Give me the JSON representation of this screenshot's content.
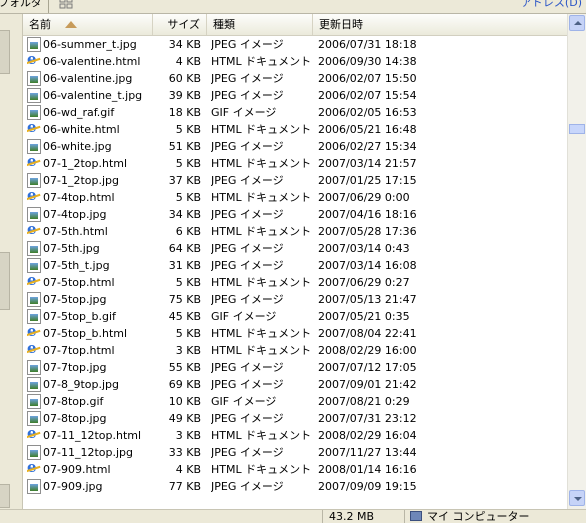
{
  "toolbar": {
    "folders_label": "フォルダ",
    "address_label": "アドレス(D)"
  },
  "columns": {
    "name": "名前",
    "size": "サイズ",
    "type": "種類",
    "modified": "更新日時"
  },
  "sort": {
    "column": "name",
    "direction": "ascending"
  },
  "files": [
    {
      "name": "06-summer_t.jpg",
      "icon": "jpeg-image-icon",
      "size": "34 KB",
      "type": "JPEG イメージ",
      "modified": "2006/07/31 18:18"
    },
    {
      "name": "06-valentine.html",
      "icon": "html-document-icon",
      "size": "4 KB",
      "type": "HTML ドキュメント",
      "modified": "2006/09/30 14:38"
    },
    {
      "name": "06-valentine.jpg",
      "icon": "jpeg-image-icon",
      "size": "60 KB",
      "type": "JPEG イメージ",
      "modified": "2006/02/07 15:50"
    },
    {
      "name": "06-valentine_t.jpg",
      "icon": "jpeg-image-icon",
      "size": "39 KB",
      "type": "JPEG イメージ",
      "modified": "2006/02/07 15:54"
    },
    {
      "name": "06-wd_raf.gif",
      "icon": "gif-image-icon",
      "size": "18 KB",
      "type": "GIF イメージ",
      "modified": "2006/02/05 16:53"
    },
    {
      "name": "06-white.html",
      "icon": "html-document-icon",
      "size": "5 KB",
      "type": "HTML ドキュメント",
      "modified": "2006/05/21 16:48"
    },
    {
      "name": "06-white.jpg",
      "icon": "jpeg-image-icon",
      "size": "51 KB",
      "type": "JPEG イメージ",
      "modified": "2006/02/27 15:34"
    },
    {
      "name": "07-1_2top.html",
      "icon": "html-document-icon",
      "size": "5 KB",
      "type": "HTML ドキュメント",
      "modified": "2007/03/14 21:57"
    },
    {
      "name": "07-1_2top.jpg",
      "icon": "jpeg-image-icon",
      "size": "37 KB",
      "type": "JPEG イメージ",
      "modified": "2007/01/25 17:15"
    },
    {
      "name": "07-4top.html",
      "icon": "html-document-icon",
      "size": "5 KB",
      "type": "HTML ドキュメント",
      "modified": "2007/06/29 0:00"
    },
    {
      "name": "07-4top.jpg",
      "icon": "jpeg-image-icon",
      "size": "34 KB",
      "type": "JPEG イメージ",
      "modified": "2007/04/16 18:16"
    },
    {
      "name": "07-5th.html",
      "icon": "html-document-icon",
      "size": "6 KB",
      "type": "HTML ドキュメント",
      "modified": "2007/05/28 17:36"
    },
    {
      "name": "07-5th.jpg",
      "icon": "jpeg-image-icon",
      "size": "64 KB",
      "type": "JPEG イメージ",
      "modified": "2007/03/14 0:43"
    },
    {
      "name": "07-5th_t.jpg",
      "icon": "jpeg-image-icon",
      "size": "31 KB",
      "type": "JPEG イメージ",
      "modified": "2007/03/14 16:08"
    },
    {
      "name": "07-5top.html",
      "icon": "html-document-icon",
      "size": "5 KB",
      "type": "HTML ドキュメント",
      "modified": "2007/06/29 0:27"
    },
    {
      "name": "07-5top.jpg",
      "icon": "jpeg-image-icon",
      "size": "75 KB",
      "type": "JPEG イメージ",
      "modified": "2007/05/13 21:47"
    },
    {
      "name": "07-5top_b.gif",
      "icon": "gif-image-icon",
      "size": "45 KB",
      "type": "GIF イメージ",
      "modified": "2007/05/21 0:35"
    },
    {
      "name": "07-5top_b.html",
      "icon": "html-document-icon",
      "size": "5 KB",
      "type": "HTML ドキュメント",
      "modified": "2007/08/04 22:41"
    },
    {
      "name": "07-7top.html",
      "icon": "html-document-icon",
      "size": "3 KB",
      "type": "HTML ドキュメント",
      "modified": "2008/02/29 16:00"
    },
    {
      "name": "07-7top.jpg",
      "icon": "jpeg-image-icon",
      "size": "55 KB",
      "type": "JPEG イメージ",
      "modified": "2007/07/12 17:05"
    },
    {
      "name": "07-8_9top.jpg",
      "icon": "jpeg-image-icon",
      "size": "69 KB",
      "type": "JPEG イメージ",
      "modified": "2007/09/01 21:42"
    },
    {
      "name": "07-8top.gif",
      "icon": "gif-image-icon",
      "size": "10 KB",
      "type": "GIF イメージ",
      "modified": "2007/08/21 0:29"
    },
    {
      "name": "07-8top.jpg",
      "icon": "jpeg-image-icon",
      "size": "49 KB",
      "type": "JPEG イメージ",
      "modified": "2007/07/31 23:12"
    },
    {
      "name": "07-11_12top.html",
      "icon": "html-document-icon",
      "size": "3 KB",
      "type": "HTML ドキュメント",
      "modified": "2008/02/29 16:04"
    },
    {
      "name": "07-11_12top.jpg",
      "icon": "jpeg-image-icon",
      "size": "33 KB",
      "type": "JPEG イメージ",
      "modified": "2007/11/27 13:44"
    },
    {
      "name": "07-909.html",
      "icon": "html-document-icon",
      "size": "4 KB",
      "type": "HTML ドキュメント",
      "modified": "2008/01/14 16:16"
    },
    {
      "name": "07-909.jpg",
      "icon": "jpeg-image-icon",
      "size": "77 KB",
      "type": "JPEG イメージ",
      "modified": "2007/09/09 19:15"
    }
  ],
  "statusbar": {
    "total_size": "43.2 MB",
    "zone": "マイ コンピューター"
  }
}
